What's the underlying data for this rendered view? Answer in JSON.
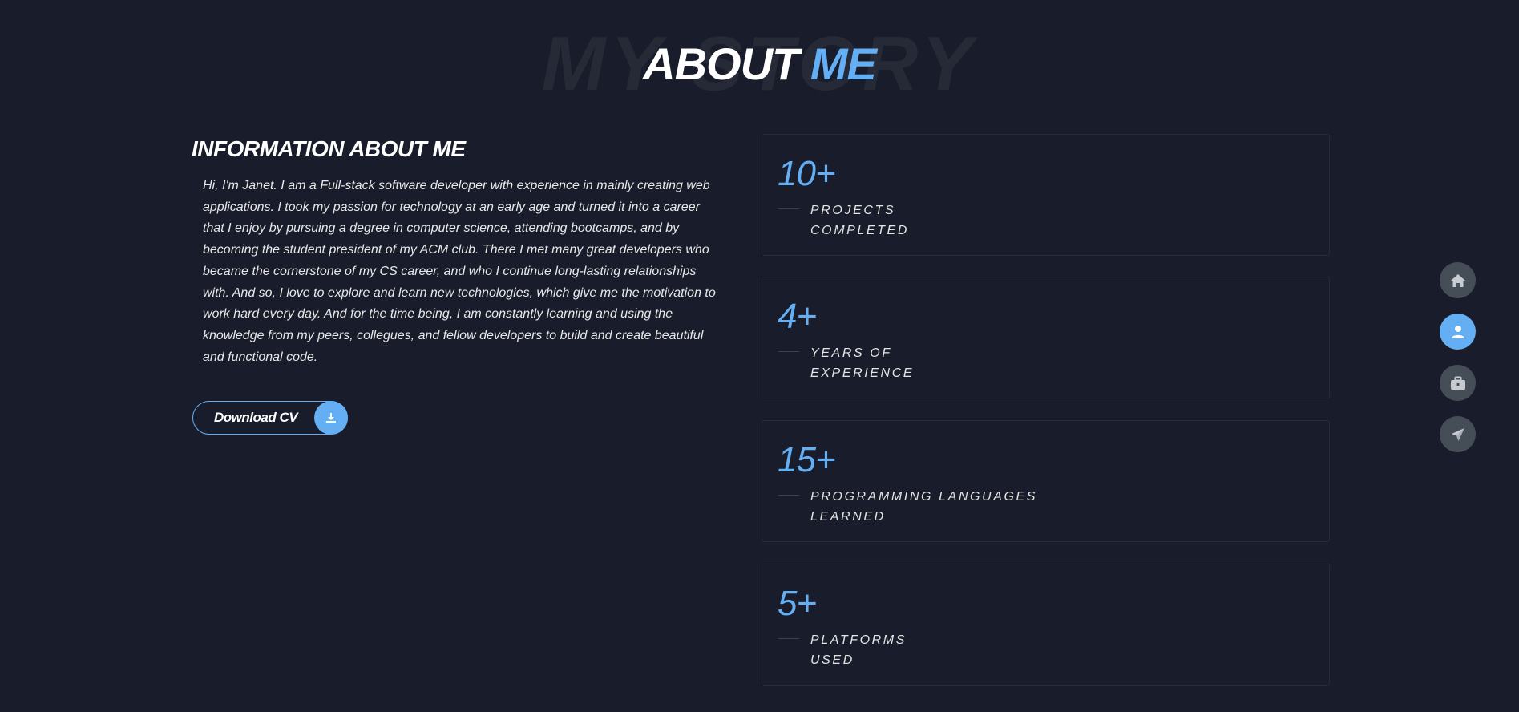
{
  "header": {
    "background_word": "MY STORY",
    "title_part1": "ABOUT",
    "title_part2": "ME"
  },
  "about": {
    "heading": "INFORMATION ABOUT ME",
    "text": "Hi, I'm Janet. I am a Full-stack software developer with experience in mainly creating web applications. I took my passion for technology at an early age and turned it into a career that I enjoy by pursuing a degree in computer science, attending bootcamps, and by becoming the student president of my ACM club. There I met many great developers who became the cornerstone of my CS career, and who I continue long-lasting relationships with. And so, I love to explore and learn new technologies, which give me the motivation to work hard every day. And for the time being, I am constantly learning and using the knowledge from my peers, collegues, and fellow developers to build and create beautiful and functional code.",
    "cv_button_label": "Download CV",
    "cv_button_icon": "download-icon"
  },
  "stats": [
    {
      "number": "10+",
      "label_line1": "PROJECTS",
      "label_line2": "COMPLETED"
    },
    {
      "number": "4+",
      "label_line1": "YEARS OF",
      "label_line2": "EXPERIENCE"
    },
    {
      "number": "15+",
      "label_line1": "PROGRAMMING LANGUAGES",
      "label_line2": "LEARNED"
    },
    {
      "number": "5+",
      "label_line1": "PLATFORMS",
      "label_line2": "USED"
    }
  ],
  "controls": [
    {
      "icon": "home-icon",
      "active": false
    },
    {
      "icon": "user-icon",
      "active": true
    },
    {
      "icon": "briefcase-icon",
      "active": false
    },
    {
      "icon": "paper-plane-icon",
      "active": false
    }
  ],
  "colors": {
    "background": "#191d2b",
    "accent": "#64aef4",
    "control_inactive": "#454e56",
    "card_border": "#262b38"
  }
}
